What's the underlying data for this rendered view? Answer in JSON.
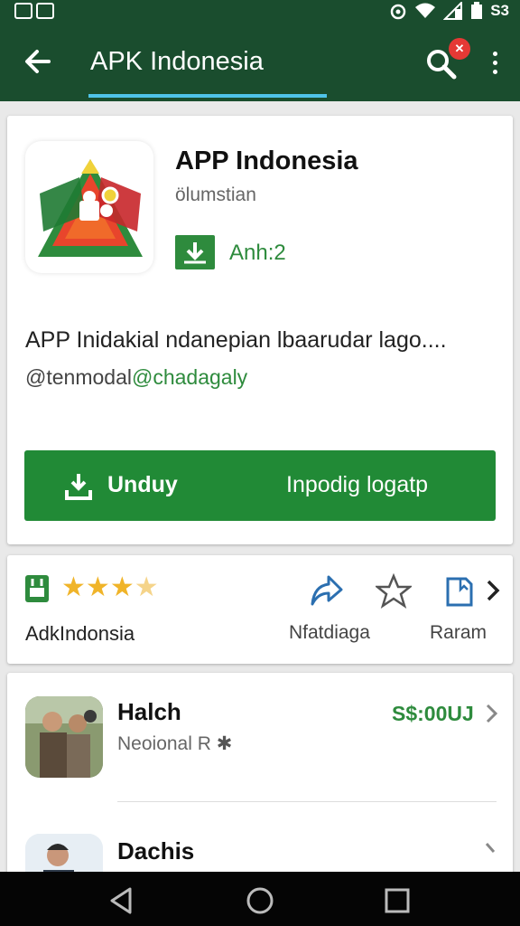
{
  "status_bar": {
    "right_text": "S3"
  },
  "app_bar": {
    "title": "APK Indonesia",
    "search_badge": "✕"
  },
  "app": {
    "name": "APP Indonesia",
    "developer": "ölumstian",
    "badge_text": "Anh:2",
    "description": "APP Inidakial ndanepian lbaarudar lago....",
    "tag_handle": "@tenmodal",
    "tag_link": "@chadagaly",
    "cta_label": "Unduy",
    "cta_secondary": "Inpodig logatp"
  },
  "rating": {
    "stars_filled": 3,
    "stars_total": 4,
    "label": "AdkIndonsia",
    "mid_label": "Nfatdiaga",
    "right_label": "Raram"
  },
  "list": {
    "items": [
      {
        "title": "Halch",
        "subtitle": "Neoional R",
        "price": "S$:00UJ"
      },
      {
        "title": "Dachis"
      }
    ]
  },
  "colors": {
    "app_bar": "#1a4d2e",
    "accent_green": "#218a36",
    "underline": "#4fc3e8",
    "star": "#f0b429"
  }
}
